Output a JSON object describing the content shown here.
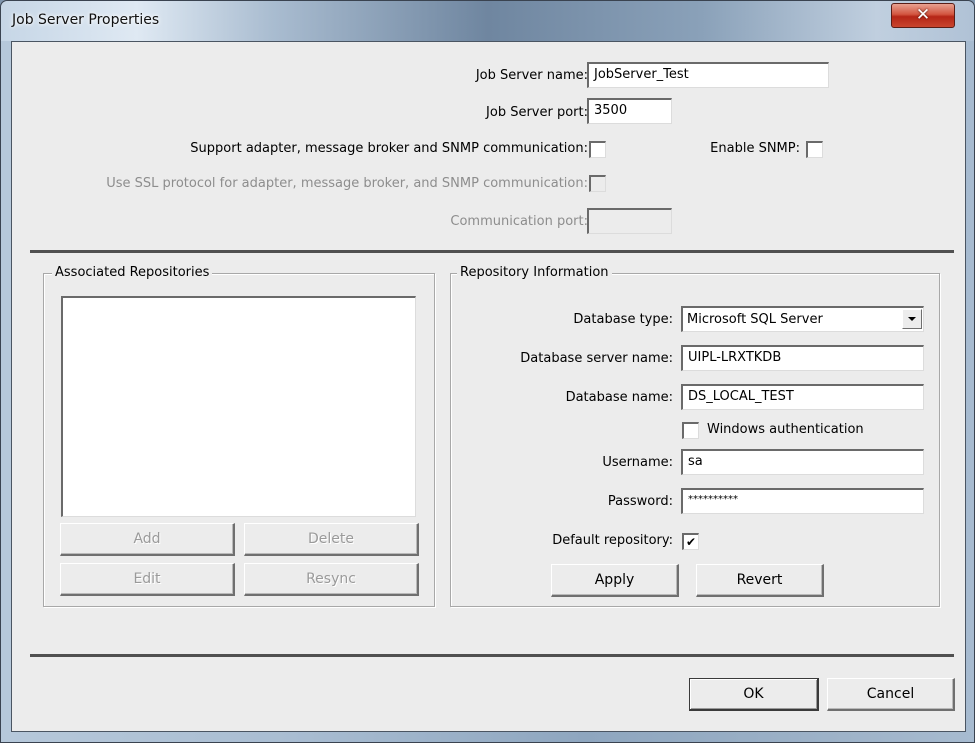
{
  "window": {
    "title": "Job Server Properties",
    "close_glyph": "✕"
  },
  "server": {
    "name_label": "Job Server name:",
    "name_value": "JobServer_Test",
    "port_label": "Job Server port:",
    "port_value": "3500",
    "support_label": "Support adapter, message broker and SNMP communication:",
    "support_checked": false,
    "enable_snmp_label": "Enable SNMP:",
    "enable_snmp_checked": false,
    "ssl_label": "Use SSL protocol for adapter, message broker, and SNMP communication:",
    "ssl_checked": false,
    "comm_port_label": "Communication port:",
    "comm_port_value": ""
  },
  "associated_repositories": {
    "title": "Associated Repositories",
    "items": [],
    "buttons": {
      "add": "Add",
      "delete": "Delete",
      "edit": "Edit",
      "resync": "Resync"
    }
  },
  "repository_info": {
    "title": "Repository Information",
    "db_type_label": "Database type:",
    "db_type_value": "Microsoft SQL Server",
    "db_server_label": "Database server name:",
    "db_server_value": "UIPL-LRXTKDB",
    "db_name_label": "Database name:",
    "db_name_value": "DS_LOCAL_TEST",
    "windows_auth_label": "Windows authentication",
    "windows_auth_checked": false,
    "username_label": "Username:",
    "username_value": "sa",
    "password_label": "Password:",
    "password_value": "**********",
    "default_repo_label": "Default repository:",
    "default_repo_checked": true,
    "check_glyph": "✔",
    "apply_label": "Apply",
    "revert_label": "Revert"
  },
  "footer": {
    "ok_label": "OK",
    "cancel_label": "Cancel"
  }
}
